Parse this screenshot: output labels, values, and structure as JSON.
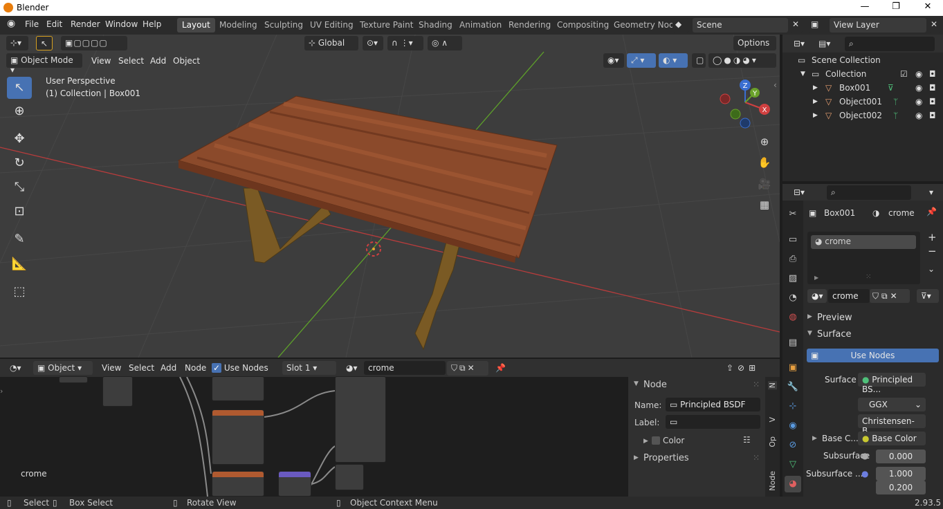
{
  "titlebar": {
    "title": "Blender",
    "minimize": "—",
    "maximize": "❐",
    "close": "✕"
  },
  "menu": {
    "file": "File",
    "edit": "Edit",
    "render": "Render",
    "window": "Window",
    "help": "Help"
  },
  "workspaces": [
    "Layout",
    "Modeling",
    "Sculpting",
    "UV Editing",
    "Texture Paint",
    "Shading",
    "Animation",
    "Rendering",
    "Compositing",
    "Geometry Nod"
  ],
  "scene": {
    "name": "Scene",
    "view_layer": "View Layer"
  },
  "viewport": {
    "transform_orientation": "Global",
    "options": "Options",
    "mode": "Object Mode",
    "menus": [
      "View",
      "Select",
      "Add",
      "Object"
    ],
    "perspective": "User Perspective",
    "collection_info": "(1) Collection | Box001"
  },
  "outliner": {
    "root": "Scene Collection",
    "collection": "Collection",
    "objects": [
      "Box001",
      "Object001",
      "Object002"
    ]
  },
  "properties": {
    "object": "Box001",
    "material": "crome",
    "slot": "crome",
    "material_field": "crome",
    "preview": "Preview",
    "surface": "Surface",
    "use_nodes": "Use Nodes",
    "surface_label": "Surface",
    "surface_value": "Principled BS...",
    "distribution": "GGX",
    "subsurface_method": "Christensen-B...",
    "base_color_label": "Base C...",
    "base_color_value": "Base Color",
    "subsurface_label": "Subsurface",
    "subsurface_value": "0.000",
    "subsurface_radius_label": "Subsurface ...",
    "subsurface_radius_1": "1.000",
    "subsurface_radius_2": "0.200"
  },
  "node_editor": {
    "editor_type": "Object",
    "menus": [
      "View",
      "Select",
      "Add",
      "Node"
    ],
    "use_nodes": "Use Nodes",
    "slot": "Slot 1",
    "material": "crome",
    "material_label": "crome"
  },
  "node_panel": {
    "title": "Node",
    "name_label": "Name:",
    "name_value": "Principled BSDF",
    "label_label": "Label:",
    "color": "Color",
    "properties": "Properties",
    "tabs": [
      "N",
      "V",
      "Op",
      "Node"
    ]
  },
  "status": {
    "select": "Select",
    "box_select": "Box Select",
    "rotate_view": "Rotate View",
    "context_menu": "Object Context Menu",
    "version": "2.93.5"
  },
  "colors": {
    "accent": "#4772b3",
    "table_wood": "#8b4a2b",
    "legs": "#7a5a24",
    "x_axis": "#b83c3c",
    "y_axis": "#5ea12a"
  }
}
